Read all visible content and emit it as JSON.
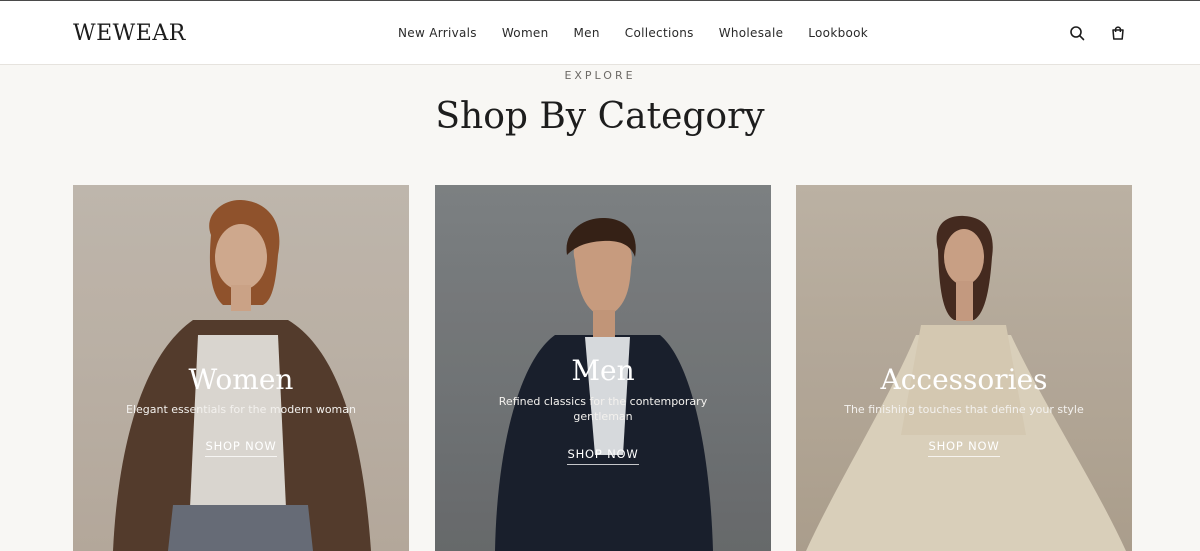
{
  "brand": {
    "logo": "WEWEAR"
  },
  "nav": {
    "items": [
      {
        "label": "New Arrivals"
      },
      {
        "label": "Women"
      },
      {
        "label": "Men"
      },
      {
        "label": "Collections"
      },
      {
        "label": "Wholesale"
      },
      {
        "label": "Lookbook"
      }
    ]
  },
  "header_icons": {
    "search": "search-icon",
    "cart": "cart-icon"
  },
  "section": {
    "eyebrow": "EXPLORE",
    "title": "Shop By Category"
  },
  "categories": [
    {
      "title": "Women",
      "subtitle": "Elegant essentials for the modern woman",
      "cta": "SHOP NOW",
      "bg": "#c9bfb4"
    },
    {
      "title": "Men",
      "subtitle": "Refined classics for the contemporary gentleman",
      "cta": "SHOP NOW",
      "bg": "#7e8284"
    },
    {
      "title": "Accessories",
      "subtitle": "The finishing touches that define your style",
      "cta": "SHOP NOW",
      "bg": "#c4b8a6"
    }
  ],
  "colors": {
    "page_bg": "#f8f7f4",
    "header_bg": "#ffffff",
    "text": "#1f1f1f"
  }
}
